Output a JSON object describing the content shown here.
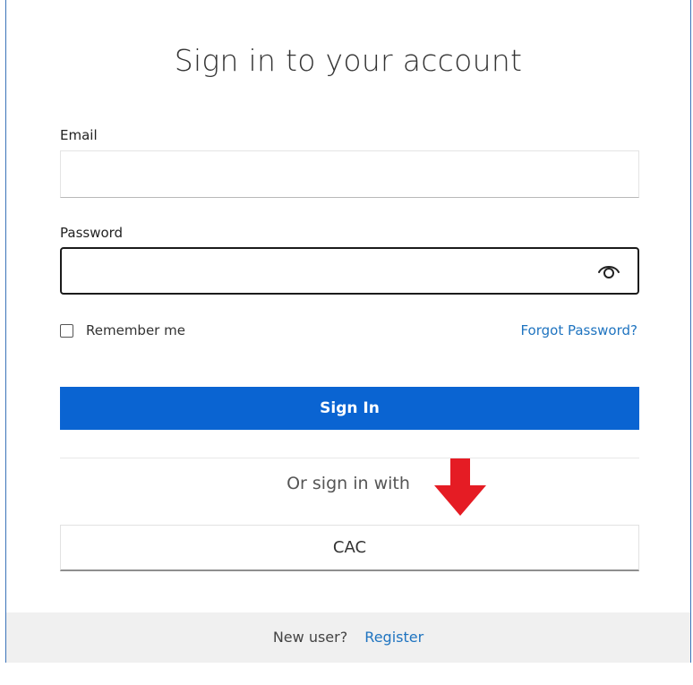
{
  "login": {
    "title": "Sign in to your account",
    "email_label": "Email",
    "email_value": "",
    "password_label": "Password",
    "password_value": "",
    "remember_label": "Remember me",
    "remember_checked": false,
    "forgot_label": "Forgot Password?",
    "signin_label": "Sign In",
    "or_text": "Or sign in with",
    "cac_label": "CAC"
  },
  "footer": {
    "new_user_text": "New user?",
    "register_label": "Register"
  },
  "icons": {
    "password_toggle": "eye-icon",
    "annotation": "down-arrow-icon"
  },
  "colors": {
    "primary": "#0a64d2",
    "link": "#1f74c0",
    "annotation_arrow": "#e51c24",
    "footer_bg": "#f0f0f0",
    "card_border": "#3b73b9"
  }
}
